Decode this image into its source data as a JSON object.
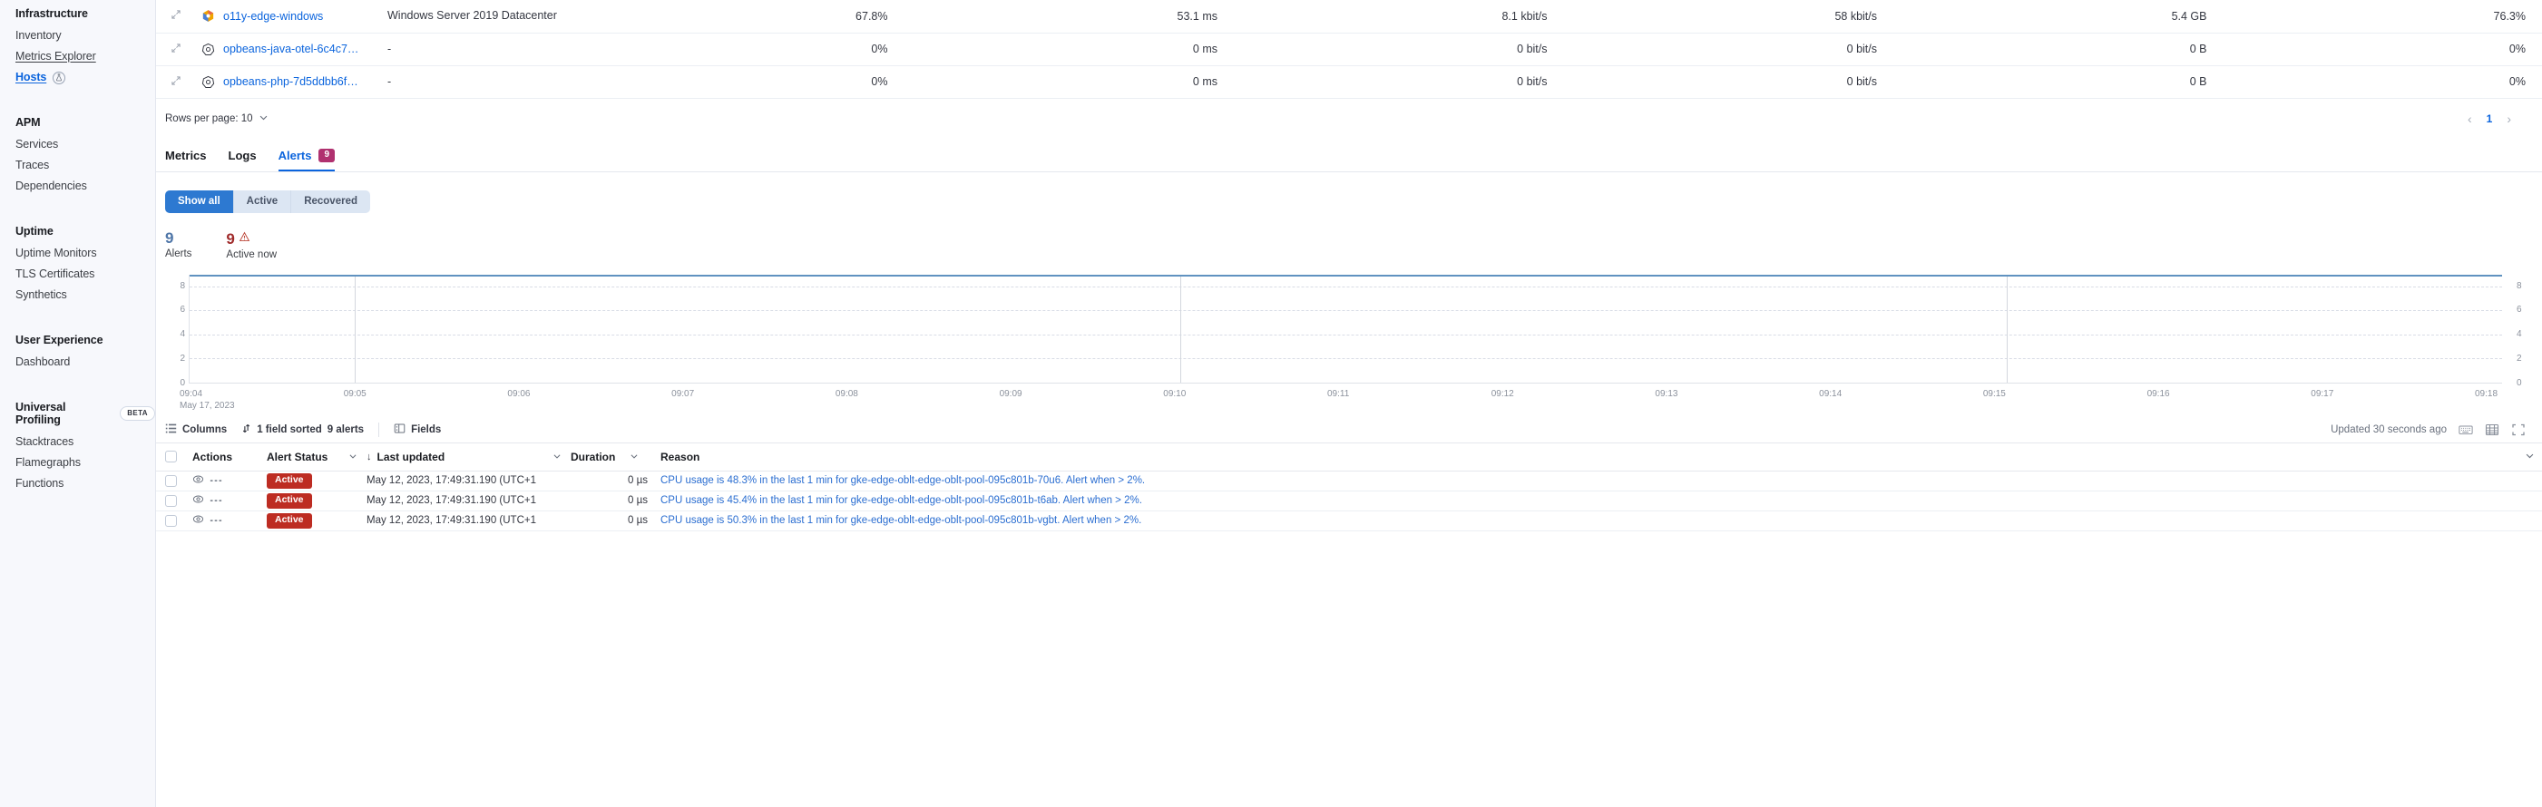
{
  "sidebar": {
    "groups": [
      {
        "title": "Infrastructure",
        "items": [
          {
            "label": "Inventory",
            "state": "normal"
          },
          {
            "label": "Metrics Explorer",
            "state": "dotted"
          },
          {
            "label": "Hosts",
            "state": "active",
            "icon": "flask-icon"
          }
        ]
      },
      {
        "title": "APM",
        "items": [
          {
            "label": "Services",
            "state": "normal"
          },
          {
            "label": "Traces",
            "state": "normal"
          },
          {
            "label": "Dependencies",
            "state": "normal"
          }
        ]
      },
      {
        "title": "Uptime",
        "items": [
          {
            "label": "Uptime Monitors",
            "state": "normal"
          },
          {
            "label": "TLS Certificates",
            "state": "normal"
          },
          {
            "label": "Synthetics",
            "state": "normal"
          }
        ]
      },
      {
        "title": "User Experience",
        "items": [
          {
            "label": "Dashboard",
            "state": "normal"
          }
        ]
      },
      {
        "title": "Universal Profiling",
        "badge": "BETA",
        "items": [
          {
            "label": "Stacktraces",
            "state": "normal"
          },
          {
            "label": "Flamegraphs",
            "state": "normal"
          },
          {
            "label": "Functions",
            "state": "normal"
          }
        ]
      }
    ]
  },
  "hosts_table": {
    "rows": [
      {
        "name": "o11y-edge-windows",
        "icon": "windows-icon",
        "os": "Windows Server 2019 Datacenter",
        "cpu": "67.8%",
        "latency": "53.1 ms",
        "rx": "8.1 kbit/s",
        "tx": "58 kbit/s",
        "memory_total": "5.4 GB",
        "memory": "76.3%"
      },
      {
        "name": "opbeans-java-otel-6c4c7…",
        "icon": "kubernetes-icon",
        "os": "-",
        "cpu": "0%",
        "latency": "0 ms",
        "rx": "0 bit/s",
        "tx": "0 bit/s",
        "memory_total": "0 B",
        "memory": "0%"
      },
      {
        "name": "opbeans-php-7d5ddbb6f…",
        "icon": "kubernetes-icon",
        "os": "-",
        "cpu": "0%",
        "latency": "0 ms",
        "rx": "0 bit/s",
        "tx": "0 bit/s",
        "memory_total": "0 B",
        "memory": "0%"
      }
    ]
  },
  "pager": {
    "rows_per_page_label": "Rows per page: 10",
    "prev": "‹",
    "page": "1",
    "next": "›"
  },
  "tabs": [
    {
      "label": "Metrics",
      "selected": false
    },
    {
      "label": "Logs",
      "selected": false
    },
    {
      "label": "Alerts",
      "selected": true,
      "badge": "9"
    }
  ],
  "filters": [
    {
      "label": "Show all",
      "active": true
    },
    {
      "label": "Active",
      "active": false
    },
    {
      "label": "Recovered",
      "active": false
    }
  ],
  "counts": [
    {
      "value": "9",
      "label": "Alerts",
      "color": "blue"
    },
    {
      "value": "9",
      "label": "Active now",
      "color": "red",
      "icon": "warning-triangle-icon"
    }
  ],
  "chart_data": {
    "type": "line",
    "title": "",
    "xlabel": "",
    "ylabel": "",
    "ylim": [
      0,
      9
    ],
    "y_ticks": [
      0,
      2,
      4,
      6,
      8
    ],
    "y_axis_both_sides": true,
    "grid": true,
    "x_start_date": "May 17, 2023",
    "x_tick_labels": [
      "09:04",
      "09:05",
      "09:06",
      "09:07",
      "09:08",
      "09:09",
      "09:10",
      "09:11",
      "09:12",
      "09:13",
      "09:14",
      "09:15",
      "09:16",
      "09:17",
      "09:18"
    ],
    "series": [
      {
        "name": "Alerts",
        "color": "#6092c0",
        "x": [
          "09:04",
          "09:05",
          "09:06",
          "09:07",
          "09:08",
          "09:09",
          "09:10",
          "09:11",
          "09:12",
          "09:13",
          "09:14",
          "09:15",
          "09:16",
          "09:17",
          "09:18"
        ],
        "values": [
          9,
          9,
          9,
          9,
          9,
          9,
          9,
          9,
          9,
          9,
          9,
          9,
          9,
          9,
          9
        ]
      }
    ],
    "annotations": [
      {
        "type": "vertical-line",
        "x": "09:05"
      },
      {
        "type": "vertical-line",
        "x": "09:10"
      },
      {
        "type": "vertical-line",
        "x": "09:15"
      }
    ]
  },
  "grid_toolbar": {
    "columns_label": "Columns",
    "sort_label": "1 field sorted",
    "alerts_label": "9 alerts",
    "fields_label": "Fields",
    "updated_label": "Updated 30 seconds ago"
  },
  "data_grid": {
    "columns": [
      {
        "key": "actions",
        "label": "Actions",
        "sortable": false
      },
      {
        "key": "status",
        "label": "Alert Status",
        "sortable": true
      },
      {
        "key": "updated",
        "label": "Last updated",
        "sortable": true,
        "sorted": "desc"
      },
      {
        "key": "duration",
        "label": "Duration",
        "sortable": true
      },
      {
        "key": "reason",
        "label": "Reason",
        "sortable": false
      }
    ],
    "rows": [
      {
        "status": "Active",
        "updated": "May 12, 2023, 17:49:31.190 (UTC+1",
        "duration": "0 µs",
        "reason": "CPU usage is 48.3% in the last 1 min for gke-edge-oblt-edge-oblt-pool-095c801b-70u6. Alert when > 2%."
      },
      {
        "status": "Active",
        "updated": "May 12, 2023, 17:49:31.190 (UTC+1",
        "duration": "0 µs",
        "reason": "CPU usage is 45.4% in the last 1 min for gke-edge-oblt-edge-oblt-pool-095c801b-t6ab. Alert when > 2%."
      },
      {
        "status": "Active",
        "updated": "May 12, 2023, 17:49:31.190 (UTC+1",
        "duration": "0 µs",
        "reason": "CPU usage is 50.3% in the last 1 min for gke-edge-oblt-edge-oblt-pool-095c801b-vgbt. Alert when > 2%."
      }
    ]
  },
  "colors": {
    "accent": "#0b64dd",
    "danger": "#bd2c22",
    "badge": "#b0316f",
    "chart_line": "#6092c0"
  }
}
